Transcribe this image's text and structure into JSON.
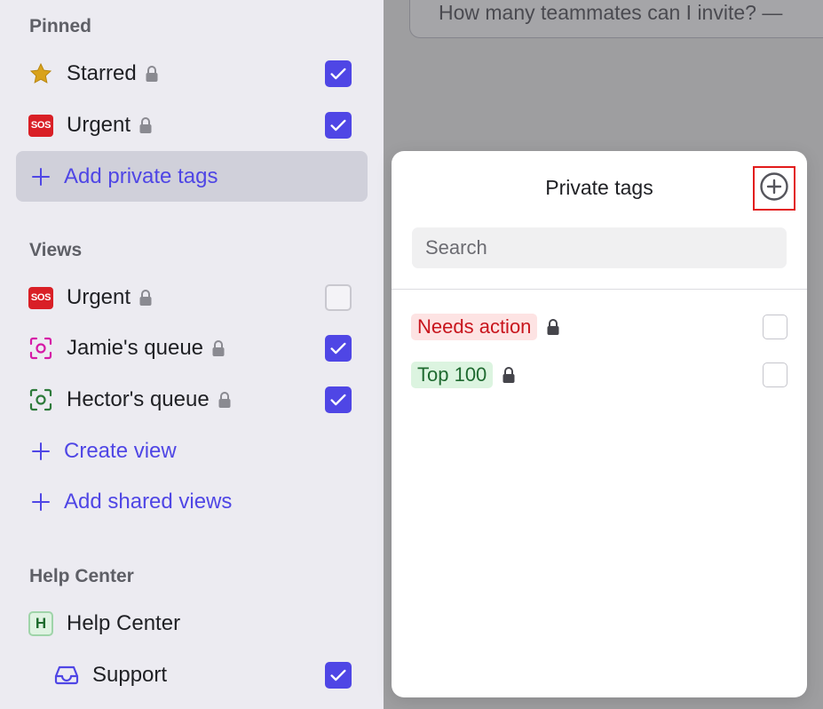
{
  "sidebar": {
    "pinned": {
      "title": "Pinned",
      "items": [
        {
          "label": "Starred",
          "icon": "star-icon",
          "locked": true,
          "checked": true
        },
        {
          "label": "Urgent",
          "icon": "sos-icon",
          "icon_text": "SOS",
          "locked": true,
          "checked": true
        }
      ],
      "action": "Add private tags"
    },
    "views": {
      "title": "Views",
      "items": [
        {
          "label": "Urgent",
          "icon": "sos-icon",
          "icon_text": "SOS",
          "locked": true,
          "checked": false
        },
        {
          "label": "Jamie's queue",
          "icon": "focus-icon",
          "locked": true,
          "checked": true
        },
        {
          "label": "Hector's queue",
          "icon": "focus-icon",
          "locked": true,
          "checked": true
        }
      ],
      "actions": [
        "Create view",
        "Add shared views"
      ]
    },
    "help_center": {
      "title": "Help Center",
      "items": [
        {
          "label": "Help Center",
          "icon": "help-center-badge",
          "icon_text": "H"
        },
        {
          "label": "Support",
          "icon": "inbox-icon",
          "checked": true
        }
      ]
    }
  },
  "question_card": {
    "text": "How many teammates can I invite? —"
  },
  "popup": {
    "title": "Private tags",
    "add_button_icon": "plus-circle-icon",
    "search_placeholder": "Search",
    "tags": [
      {
        "label": "Needs action",
        "style": "red",
        "locked": true,
        "checked": false
      },
      {
        "label": "Top 100",
        "style": "green",
        "locked": true,
        "checked": false
      }
    ]
  },
  "colors": {
    "accent": "#4f46e5",
    "sidebar_bg": "#ecebf1",
    "overlay_bg": "#9e9ea0",
    "highlight_box": "#e21b1b"
  }
}
